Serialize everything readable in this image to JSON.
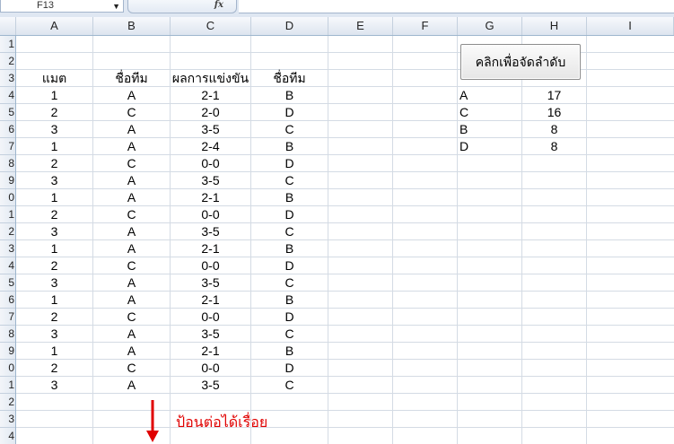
{
  "name_box": {
    "value": "F13"
  },
  "formula_bar": {
    "fx_label": "fx",
    "content": ""
  },
  "columns": [
    "A",
    "B",
    "C",
    "D",
    "E",
    "F",
    "G",
    "H",
    "I"
  ],
  "row_numbers": [
    "1",
    "2",
    "3",
    "4",
    "5",
    "6",
    "7",
    "8",
    "9",
    "0",
    "1",
    "2",
    "3",
    "4",
    "5",
    "6",
    "7",
    "8",
    "9",
    "0",
    "1",
    "2",
    "3",
    "4"
  ],
  "headers": {
    "match": "แมต",
    "team1": "ชื่อทีม",
    "result": "ผลการแข่งขัน",
    "team2": "ชื่อทีม"
  },
  "matches": [
    {
      "match": "1",
      "team1": "A",
      "result": "2-1",
      "team2": "B"
    },
    {
      "match": "2",
      "team1": "C",
      "result": "2-0",
      "team2": "D"
    },
    {
      "match": "3",
      "team1": "A",
      "result": "3-5",
      "team2": "C"
    },
    {
      "match": "1",
      "team1": "A",
      "result": "2-4",
      "team2": "B"
    },
    {
      "match": "2",
      "team1": "C",
      "result": "0-0",
      "team2": "D"
    },
    {
      "match": "3",
      "team1": "A",
      "result": "3-5",
      "team2": "C"
    },
    {
      "match": "1",
      "team1": "A",
      "result": "2-1",
      "team2": "B"
    },
    {
      "match": "2",
      "team1": "C",
      "result": "0-0",
      "team2": "D"
    },
    {
      "match": "3",
      "team1": "A",
      "result": "3-5",
      "team2": "C"
    },
    {
      "match": "1",
      "team1": "A",
      "result": "2-1",
      "team2": "B"
    },
    {
      "match": "2",
      "team1": "C",
      "result": "0-0",
      "team2": "D"
    },
    {
      "match": "3",
      "team1": "A",
      "result": "3-5",
      "team2": "C"
    },
    {
      "match": "1",
      "team1": "A",
      "result": "2-1",
      "team2": "B"
    },
    {
      "match": "2",
      "team1": "C",
      "result": "0-0",
      "team2": "D"
    },
    {
      "match": "3",
      "team1": "A",
      "result": "3-5",
      "team2": "C"
    },
    {
      "match": "1",
      "team1": "A",
      "result": "2-1",
      "team2": "B"
    },
    {
      "match": "2",
      "team1": "C",
      "result": "0-0",
      "team2": "D"
    },
    {
      "match": "3",
      "team1": "A",
      "result": "3-5",
      "team2": "C"
    }
  ],
  "standings": [
    {
      "team": "A",
      "points": "17"
    },
    {
      "team": "C",
      "points": "16"
    },
    {
      "team": "B",
      "points": "8"
    },
    {
      "team": "D",
      "points": "8"
    }
  ],
  "sort_button": {
    "label": "คลิกเพื่อจัดลำดับ"
  },
  "note": {
    "text": "ป้อนต่อได้เรื่อย",
    "color": "#e00000"
  }
}
